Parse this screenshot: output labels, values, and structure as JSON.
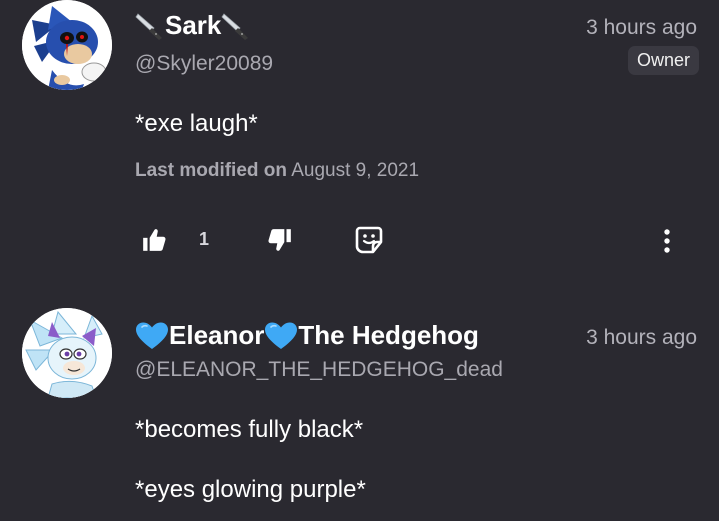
{
  "comments": [
    {
      "author": {
        "name": "Sark",
        "name_prefix_icon": "knife-emoji-icon",
        "name_suffix_icon": "knife-emoji-icon",
        "handle": "@Skyler20089",
        "avatar_icon": "sonic-exe-avatar"
      },
      "timestamp": "3 hours ago",
      "badge": "Owner",
      "body": [
        "*exe laugh*"
      ],
      "modified_label": "Last modified on",
      "modified_date": "August 9, 2021",
      "actions": {
        "like_icon": "thumbs-up-icon",
        "like_count": "1",
        "dislike_icon": "thumbs-down-icon",
        "reply_icon": "reply-sticker-icon",
        "more_icon": "more-vertical-icon"
      }
    },
    {
      "author": {
        "name_part1": "Eleanor",
        "name_part2": "The Hedgehog",
        "name_icons": [
          "blue-heart-icon",
          "blue-heart-icon"
        ],
        "handle": "@ELEANOR_THE_HEDGEHOG_dead",
        "avatar_icon": "hedgehog-oc-avatar"
      },
      "timestamp": "3 hours ago",
      "body": [
        "*becomes fully black*",
        "*eyes glowing purple*"
      ]
    }
  ],
  "colors": {
    "background": "#2a2930",
    "primary_text": "#ffffff",
    "secondary_text": "#a9a8b0",
    "badge_background": "#3a3941",
    "heart_blue": "#3fa9f5"
  }
}
